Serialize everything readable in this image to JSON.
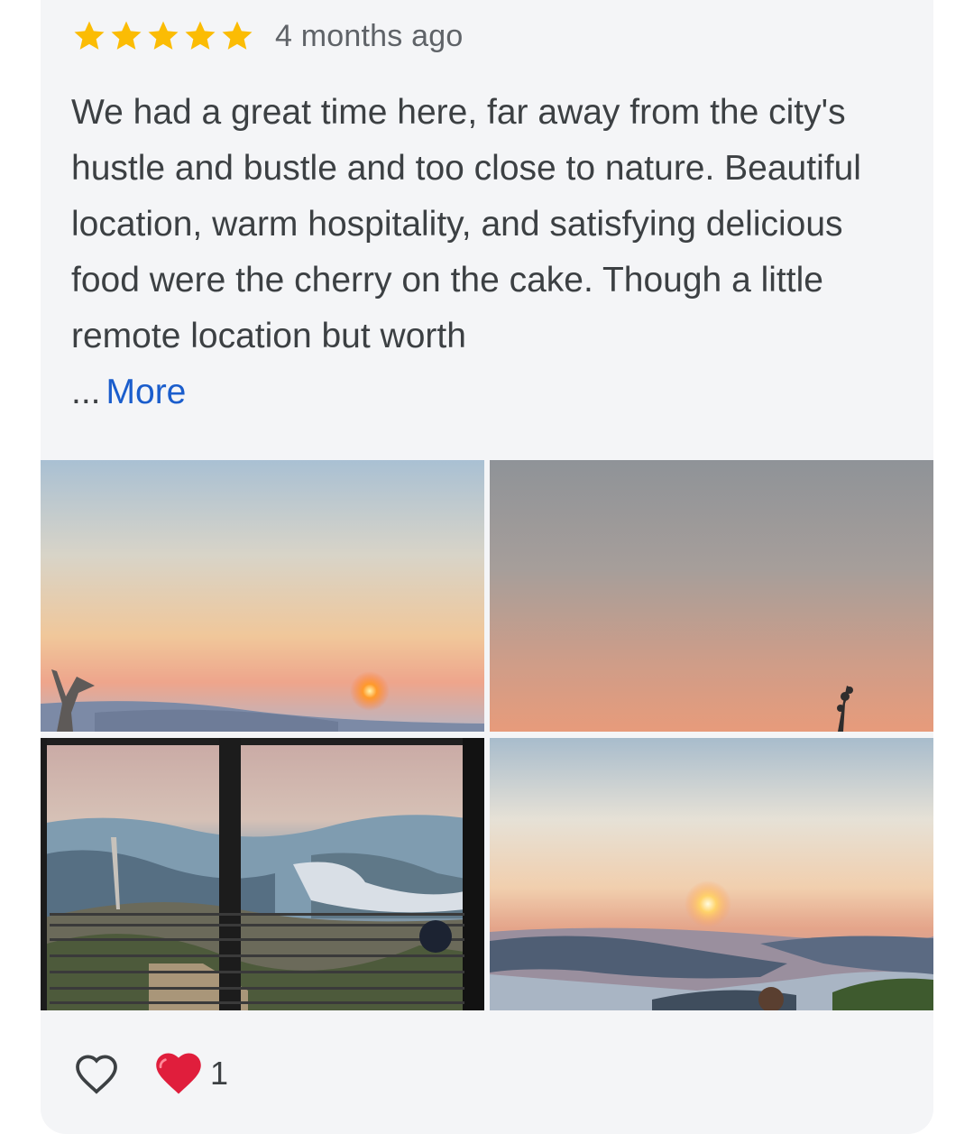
{
  "review": {
    "rating": 5,
    "max_rating": 5,
    "time_ago": "4 months ago",
    "text": "We had a great time here, far away from the city's hustle and bustle and too close to nature. Beautiful location, warm hospitality, and satisfying delicious food were the cherry on the cake. Though a little remote location but worth",
    "ellipsis": "...",
    "more_label": "More"
  },
  "colors": {
    "star": "#fbbc04",
    "link": "#1a5dcc",
    "heart": "#e01e3c"
  },
  "photos": [
    {
      "icon": "sunset-over-valley-photo"
    },
    {
      "icon": "hazy-sky-photo"
    },
    {
      "icon": "window-view-river-photo"
    },
    {
      "icon": "sunset-river-photo"
    }
  ],
  "reactions": {
    "like_icon": "heart-outline-icon",
    "heart_icon": "red-heart-icon",
    "count": "1"
  }
}
